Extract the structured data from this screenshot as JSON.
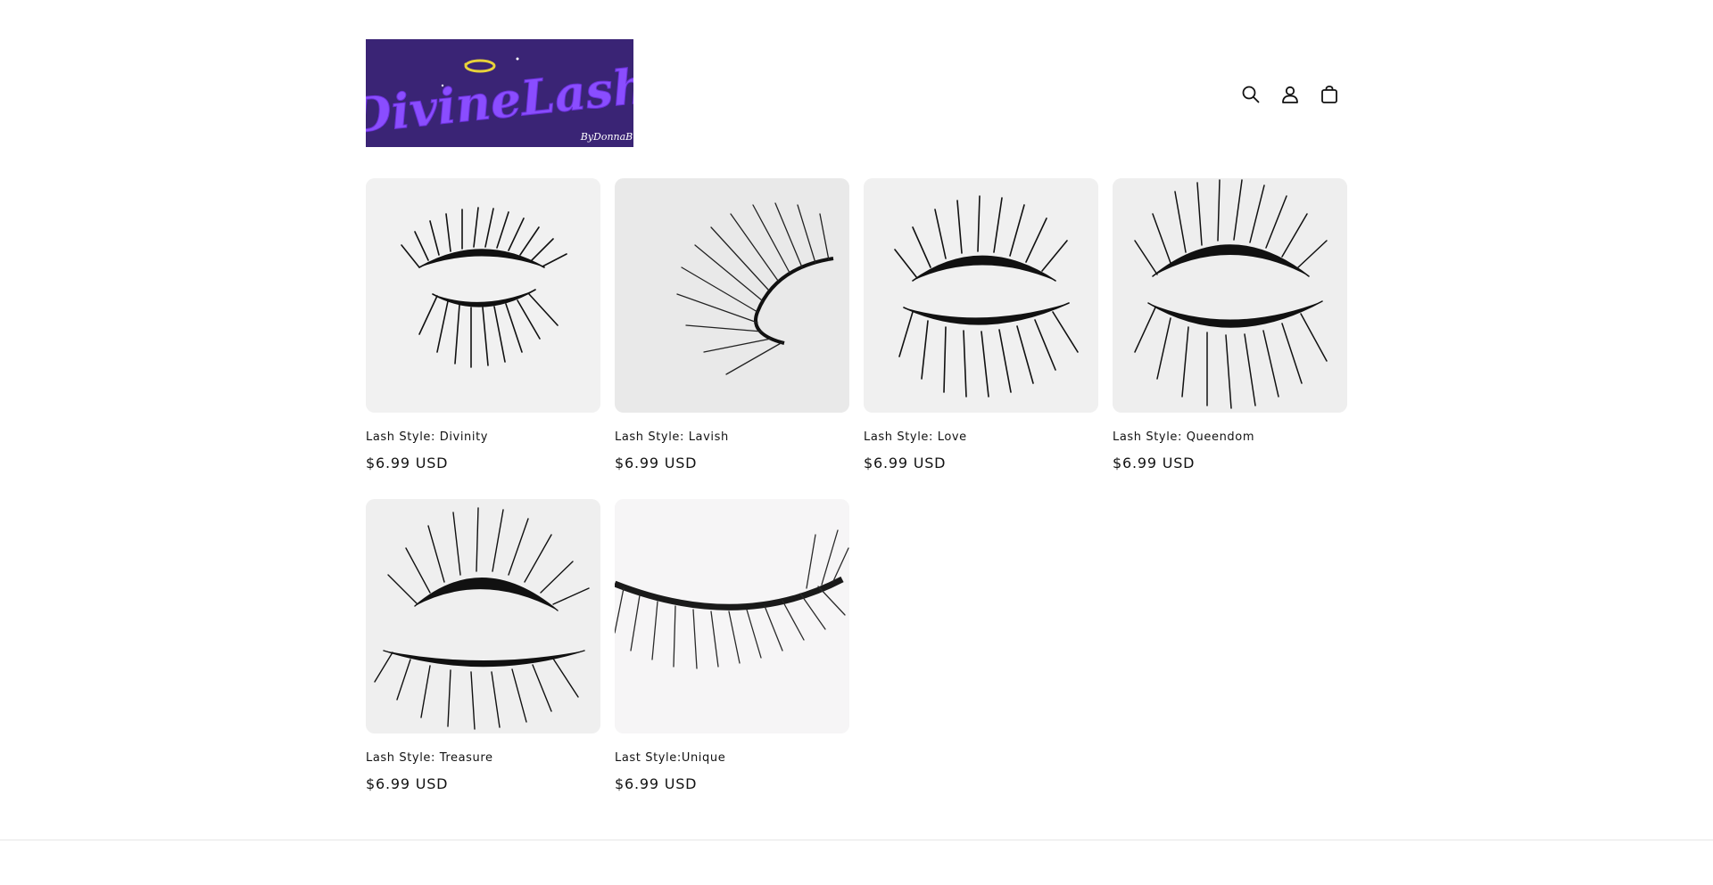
{
  "header": {
    "logo": {
      "wordmark": "DivineLash",
      "byline": "ByDonnaB"
    },
    "icons": [
      {
        "name": "search-icon",
        "label": "Search"
      },
      {
        "name": "account-icon",
        "label": "Log in"
      },
      {
        "name": "cart-icon",
        "label": "Cart"
      }
    ]
  },
  "colors": {
    "logo_background": "#3a2475",
    "logo_text": "#8a4dff",
    "halo": "#e8d23a",
    "text": "#121212",
    "image_background": "#f3f3f3"
  },
  "products": [
    {
      "title": "Lash Style: Divinity",
      "price": "$6.99 USD",
      "image": "lash-pair-fluffy"
    },
    {
      "title": "Lash Style: Lavish",
      "price": "$6.99 USD",
      "image": "lash-single-side"
    },
    {
      "title": "Lash Style: Love",
      "price": "$6.99 USD",
      "image": "lash-pair-spiky"
    },
    {
      "title": "Lash Style: Queendom",
      "price": "$6.99 USD",
      "image": "lash-pair-wispy"
    },
    {
      "title": "Lash Style: Treasure",
      "price": "$6.99 USD",
      "image": "lash-pair-long"
    },
    {
      "title": "Last Style:Unique",
      "price": "$6.99 USD",
      "image": "lash-strip-closeup"
    }
  ]
}
